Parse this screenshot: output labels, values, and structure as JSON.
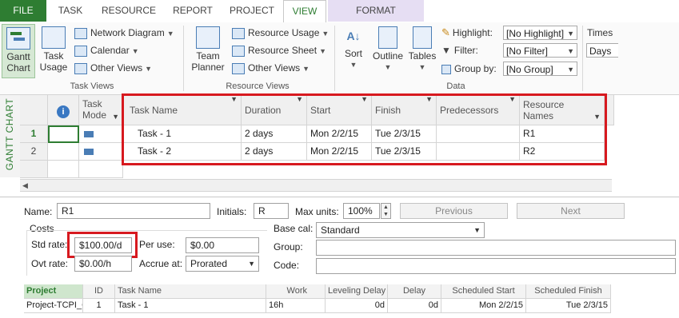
{
  "ribbon_tabs": [
    "FILE",
    "TASK",
    "RESOURCE",
    "REPORT",
    "PROJECT",
    "VIEW",
    "FORMAT"
  ],
  "task_views": {
    "gantt_chart": "Gantt Chart",
    "task_usage": "Task Usage",
    "network_diagram": "Network Diagram",
    "calendar": "Calendar",
    "other_views": "Other Views",
    "group_label": "Task Views"
  },
  "resource_views": {
    "team_planner": "Team Planner",
    "resource_usage": "Resource Usage",
    "resource_sheet": "Resource Sheet",
    "other_views": "Other Views",
    "group_label": "Resource Views"
  },
  "data_group": {
    "sort": "Sort",
    "outline": "Outline",
    "tables": "Tables",
    "highlight_label": "Highlight:",
    "highlight_value": "[No Highlight]",
    "filter_label": "Filter:",
    "filter_value": "[No Filter]",
    "group_by_label": "Group by:",
    "group_by_value": "[No Group]",
    "group_label": "Data"
  },
  "timescale": {
    "label": "Times",
    "value": "Days"
  },
  "sidebar_label": "GANTT CHART",
  "gantt": {
    "headers": {
      "info": "i",
      "task_mode": "Task Mode",
      "task_name": "Task Name",
      "duration": "Duration",
      "start": "Start",
      "finish": "Finish",
      "predecessors": "Predecessors",
      "resource_names": "Resource Names"
    },
    "rows": [
      {
        "id": "1",
        "name": "Task - 1",
        "duration": "2 days",
        "start": "Mon 2/2/15",
        "finish": "Tue 2/3/15",
        "predecessors": "",
        "resources": "R1"
      },
      {
        "id": "2",
        "name": "Task - 2",
        "duration": "2 days",
        "start": "Mon 2/2/15",
        "finish": "Tue 2/3/15",
        "predecessors": "",
        "resources": "R2"
      }
    ]
  },
  "form": {
    "name_label": "Name:",
    "name_value": "R1",
    "initials_label": "Initials:",
    "initials_value": "R",
    "max_units_label": "Max units:",
    "max_units_value": "100%",
    "previous_button": "Previous",
    "next_button": "Next",
    "costs_label": "Costs",
    "std_rate_label": "Std rate:",
    "std_rate_value": "$100.00/d",
    "per_use_label": "Per use:",
    "per_use_value": "$0.00",
    "ovt_rate_label": "Ovt rate:",
    "ovt_rate_value": "$0.00/h",
    "accrue_at_label": "Accrue at:",
    "accrue_at_value": "Prorated",
    "base_cal_label": "Base cal:",
    "base_cal_value": "Standard",
    "group_label": "Group:",
    "group_value": "",
    "code_label": "Code:",
    "code_value": ""
  },
  "assignments": {
    "headers": [
      "Project",
      "ID",
      "Task Name",
      "Work",
      "Leveling Delay",
      "Delay",
      "Scheduled Start",
      "Scheduled Finish"
    ],
    "rows": [
      {
        "project": "Project-TCPI_C",
        "id": "1",
        "task_name": "Task - 1",
        "work": "16h",
        "leveling_delay": "0d",
        "delay": "0d",
        "scheduled_start": "Mon 2/2/15",
        "scheduled_finish": "Tue 2/3/15"
      }
    ]
  },
  "colors": {
    "accent": "#2e7d32",
    "highlight_box": "#d7191f",
    "format_tab": "#e6def3"
  }
}
